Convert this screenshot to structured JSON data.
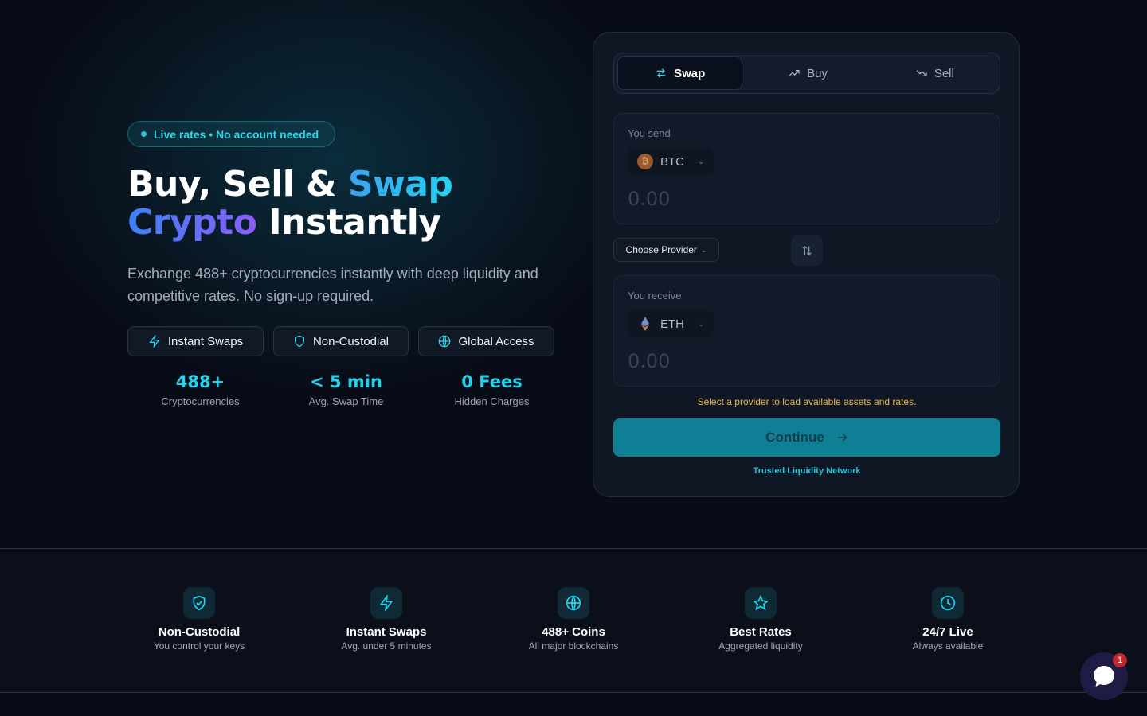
{
  "colors": {
    "accent": "#22d3ee",
    "warning": "#e8b84a",
    "cta": "#0e7f95",
    "background": "#080c16"
  },
  "hero": {
    "badge": "Live rates • No account needed",
    "headline_part1": "Buy, Sell & ",
    "headline_highlight1": "Swap",
    "headline_highlight2": "Crypto",
    "headline_part2": " Instantly",
    "subtitle": "Exchange 488+ cryptocurrencies instantly with deep liquidity and competitive rates. No sign-up required.",
    "pills": [
      {
        "label": "Instant Swaps",
        "icon": "lightning-icon"
      },
      {
        "label": "Non-Custodial",
        "icon": "shield-icon"
      },
      {
        "label": "Global Access",
        "icon": "globe-icon"
      }
    ],
    "stats": [
      {
        "value": "488+",
        "label": "Cryptocurrencies"
      },
      {
        "value": "< 5 min",
        "label": "Avg. Swap Time"
      },
      {
        "value": "0 Fees",
        "label": "Hidden Charges"
      }
    ]
  },
  "widget": {
    "tabs": [
      {
        "label": "Swap",
        "icon": "swap-arrows-icon",
        "active": true
      },
      {
        "label": "Buy",
        "icon": "trend-up-icon",
        "active": false
      },
      {
        "label": "Sell",
        "icon": "trend-down-icon",
        "active": false
      }
    ],
    "send": {
      "label": "You send",
      "coin": "BTC",
      "coin_icon_glyph": "₿",
      "amount_placeholder": "0.00"
    },
    "receive": {
      "label": "You receive",
      "coin": "ETH",
      "amount_placeholder": "0.00"
    },
    "provider_button": "Choose Provider",
    "notice": "Select a provider to load available assets and rates.",
    "continue_label": "Continue",
    "trusted": "Trusted Liquidity Network"
  },
  "features": [
    {
      "icon": "shield-check-icon",
      "title": "Non-Custodial",
      "desc": "You control your keys"
    },
    {
      "icon": "lightning-icon",
      "title": "Instant Swaps",
      "desc": "Avg. under 5 minutes"
    },
    {
      "icon": "globe-icon",
      "title": "488+ Coins",
      "desc": "All major blockchains"
    },
    {
      "icon": "star-icon",
      "title": "Best Rates",
      "desc": "Aggregated liquidity"
    },
    {
      "icon": "clock-icon",
      "title": "24/7 Live",
      "desc": "Always available"
    }
  ],
  "chat": {
    "unread_count": "1"
  }
}
